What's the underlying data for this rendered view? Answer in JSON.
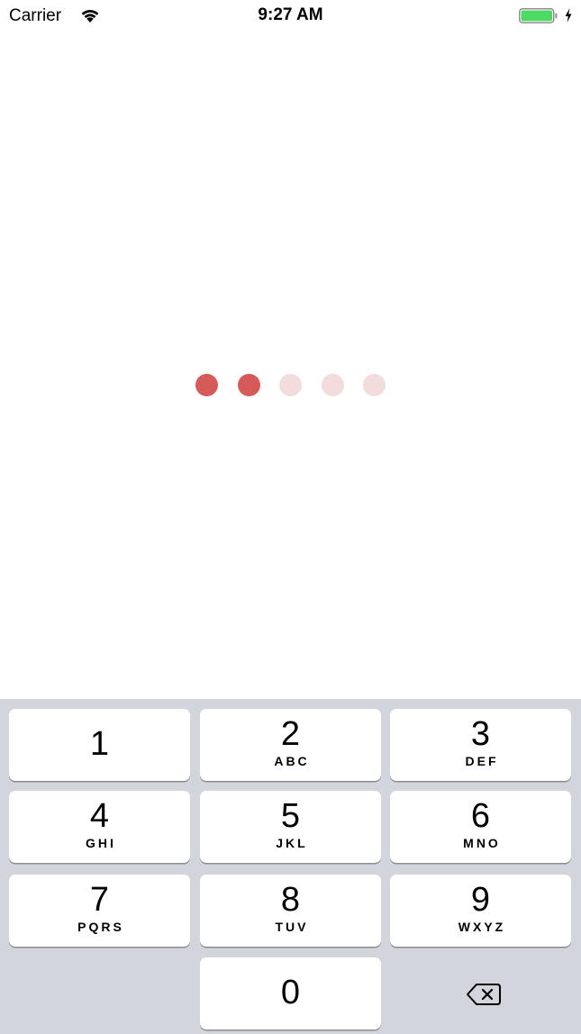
{
  "status_bar": {
    "carrier": "Carrier",
    "time": "9:27 AM",
    "battery_color": "#4cd964"
  },
  "passcode": {
    "entered": 2,
    "total": 5,
    "filled_color": "#d75a5a",
    "empty_color": "#f3dcdc"
  },
  "keypad": {
    "keys": [
      {
        "digit": "1",
        "letters": ""
      },
      {
        "digit": "2",
        "letters": "ABC"
      },
      {
        "digit": "3",
        "letters": "DEF"
      },
      {
        "digit": "4",
        "letters": "GHI"
      },
      {
        "digit": "5",
        "letters": "JKL"
      },
      {
        "digit": "6",
        "letters": "MNO"
      },
      {
        "digit": "7",
        "letters": "PQRS"
      },
      {
        "digit": "8",
        "letters": "TUV"
      },
      {
        "digit": "9",
        "letters": "WXYZ"
      },
      {
        "digit": "0",
        "letters": ""
      }
    ],
    "backspace_icon": "delete-backward-icon",
    "background_color": "#d2d5db"
  }
}
